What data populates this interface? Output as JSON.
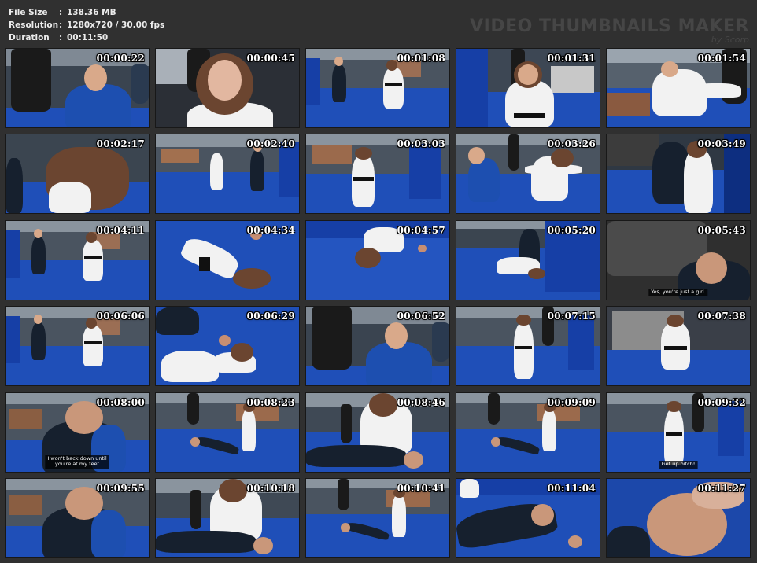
{
  "info": {
    "file_size_label": "File Size",
    "file_size_value": "138.36 MB",
    "resolution_label": "Resolution",
    "resolution_value": "1280x720 / 30.00 fps",
    "duration_label": "Duration",
    "duration_value": "00:11:50",
    "separator": ":"
  },
  "watermark": {
    "title": "VIDEO THUMBNAILS MAKER",
    "by": "by Scorp"
  },
  "thumbnails": [
    {
      "time": "00:00:22",
      "scene": "closeup-man-bag"
    },
    {
      "time": "00:00:45",
      "scene": "closeup-woman"
    },
    {
      "time": "00:01:08",
      "scene": "gym-two-fight"
    },
    {
      "time": "00:01:31",
      "scene": "woman-guard"
    },
    {
      "time": "00:01:54",
      "scene": "kick-lean"
    },
    {
      "time": "00:02:17",
      "scene": "hair-flip"
    },
    {
      "time": "00:02:40",
      "scene": "gym-wide-two"
    },
    {
      "time": "00:03:03",
      "scene": "woman-center"
    },
    {
      "time": "00:03:26",
      "scene": "kick-man"
    },
    {
      "time": "00:03:49",
      "scene": "clinch"
    },
    {
      "time": "00:04:11",
      "scene": "gym-two-fight"
    },
    {
      "time": "00:04:34",
      "scene": "woman-floor"
    },
    {
      "time": "00:04:57",
      "scene": "woman-floor-2"
    },
    {
      "time": "00:05:20",
      "scene": "man-over-woman"
    },
    {
      "time": "00:05:43",
      "scene": "man-back-poster"
    },
    {
      "time": "00:06:06",
      "scene": "gym-two-fight"
    },
    {
      "time": "00:06:29",
      "scene": "woman-floor-legs"
    },
    {
      "time": "00:06:52",
      "scene": "closeup-man-bag"
    },
    {
      "time": "00:07:15",
      "scene": "woman-standing"
    },
    {
      "time": "00:07:38",
      "scene": "woman-standing-poster"
    },
    {
      "time": "00:08:00",
      "scene": "closeup-man-wide"
    },
    {
      "time": "00:08:23",
      "scene": "man-floor-woman"
    },
    {
      "time": "00:08:46",
      "scene": "woman-over-man"
    },
    {
      "time": "00:09:09",
      "scene": "man-floor-woman"
    },
    {
      "time": "00:09:32",
      "scene": "woman-standing"
    },
    {
      "time": "00:09:55",
      "scene": "closeup-man-wide"
    },
    {
      "time": "00:10:18",
      "scene": "woman-over-man"
    },
    {
      "time": "00:10:41",
      "scene": "man-floor-woman"
    },
    {
      "time": "00:11:04",
      "scene": "man-floor-close"
    },
    {
      "time": "00:11:27",
      "scene": "man-face-floor"
    }
  ],
  "subtitles": {
    "t14": "Yes, you're just a girl.",
    "t20": "I won't back down until\nyou're at my feet",
    "t24": "Get up bitch!"
  },
  "colors": {
    "background": "#303030",
    "mat_blue": "#1f4fb8",
    "wall_gray": "#4a5460",
    "timestamp": "#ffffff"
  }
}
